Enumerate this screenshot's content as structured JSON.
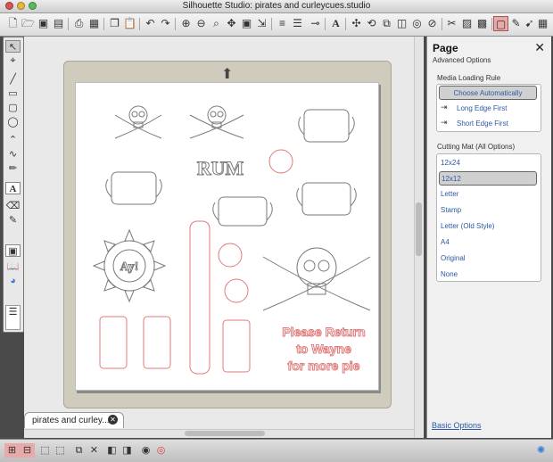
{
  "window": {
    "title": "Silhouette Studio: pirates and curleycues.studio"
  },
  "toolbar": {
    "icons": [
      "new-doc-icon",
      "open-icon",
      "save-icon",
      "save-as-icon",
      "print-icon",
      "cut-settings-icon",
      "copy-icon",
      "paste-icon",
      "undo-icon",
      "redo-icon",
      "zoom-in-icon",
      "zoom-out-icon",
      "zoom-box-icon",
      "pan-icon",
      "fit-page-icon",
      "measure-icon",
      "line-style-icon",
      "line-color-icon",
      "line-end-icon",
      "text-icon",
      "move-icon",
      "rotate-icon",
      "replicate-icon",
      "weld-icon",
      "offset-icon",
      "trace-icon",
      "knife-icon",
      "fill-color-icon",
      "fill-gradient-icon",
      "fill-pattern-icon",
      "page-settings-icon",
      "cut-style-icon",
      "send-icon",
      "expand-icon",
      "grid-icon"
    ]
  },
  "design": {
    "rum_text": "RUM",
    "aye_text": "Ay!",
    "return_text": [
      "Please Return",
      "to Wayne",
      "for more pie"
    ],
    "cut_color": "#e07a7a",
    "line_color": "#7a7a7a"
  },
  "doc_tab": {
    "name": "pirates and curley..."
  },
  "panel": {
    "title": "Page",
    "subtitle": "Advanced Options",
    "media_heading": "Media Loading Rule",
    "media_options": [
      {
        "label": "Choose Automatically",
        "selected": true
      },
      {
        "label": "Long Edge First",
        "selected": false
      },
      {
        "label": "Short Edge First",
        "selected": false
      }
    ],
    "mat_heading": "Cutting Mat (All Options)",
    "mat_options": [
      {
        "label": "12x24",
        "selected": false
      },
      {
        "label": "12x12",
        "selected": true
      },
      {
        "label": "Letter",
        "selected": false
      },
      {
        "label": "Stamp",
        "selected": false
      },
      {
        "label": "Letter (Old Style)",
        "selected": false
      },
      {
        "label": "A4",
        "selected": false
      },
      {
        "label": "Original",
        "selected": false
      },
      {
        "label": "None",
        "selected": false
      }
    ],
    "basic_link": "Basic Options"
  }
}
